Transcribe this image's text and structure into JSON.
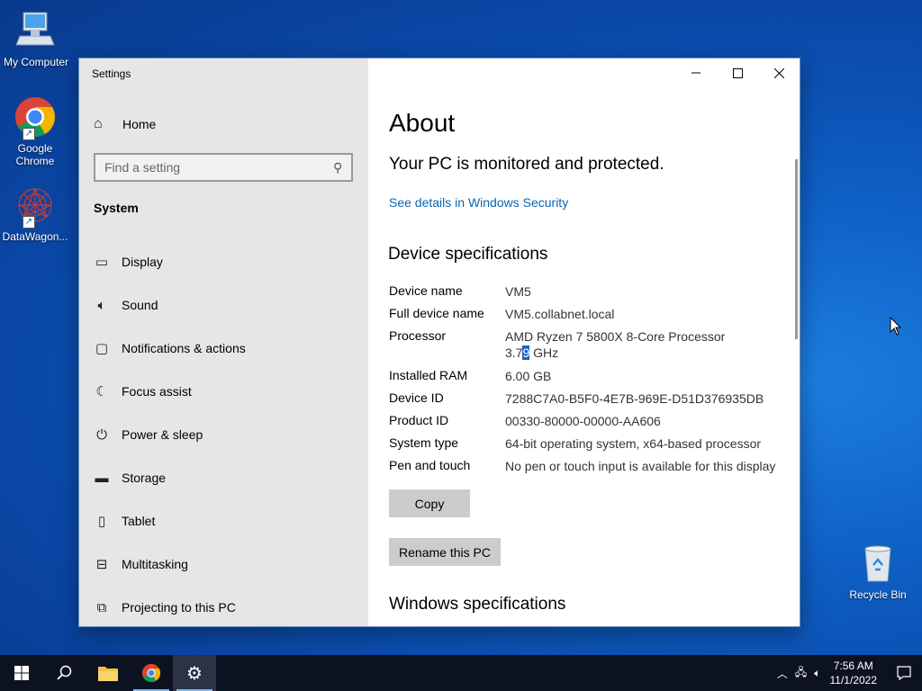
{
  "desktop": {
    "icons": [
      {
        "label": "My Computer"
      },
      {
        "label": "Google Chrome"
      },
      {
        "label": "DataWagon..."
      }
    ],
    "recycle_bin": "Recycle Bin"
  },
  "window": {
    "title": "Settings",
    "sidebar": {
      "home": "Home",
      "search_placeholder": "Find a setting",
      "section": "System",
      "items": [
        {
          "label": "Display",
          "icon": "display-icon"
        },
        {
          "label": "Sound",
          "icon": "sound-icon"
        },
        {
          "label": "Notifications & actions",
          "icon": "notifications-icon"
        },
        {
          "label": "Focus assist",
          "icon": "moon-icon"
        },
        {
          "label": "Power & sleep",
          "icon": "power-icon"
        },
        {
          "label": "Storage",
          "icon": "storage-icon"
        },
        {
          "label": "Tablet",
          "icon": "tablet-icon"
        },
        {
          "label": "Multitasking",
          "icon": "multitasking-icon"
        },
        {
          "label": "Projecting to this PC",
          "icon": "projecting-icon"
        }
      ]
    },
    "content": {
      "title": "About",
      "status": "Your PC is monitored and protected.",
      "security_link": "See details in Windows Security",
      "device_heading": "Device specifications",
      "specs": [
        {
          "key": "Device name",
          "value": "VM5"
        },
        {
          "key": "Full device name",
          "value": "VM5.collabnet.local"
        },
        {
          "key": "Processor",
          "value": "AMD Ryzen 7 5800X 8-Core Processor",
          "value2_pre": "3.7",
          "value2_sel": "9",
          "value2_post": " GHz"
        },
        {
          "key": "Installed RAM",
          "value": "6.00 GB"
        },
        {
          "key": "Device ID",
          "value": "7288C7A0-B5F0-4E7B-969E-D51D376935DB"
        },
        {
          "key": "Product ID",
          "value": "00330-80000-00000-AA606"
        },
        {
          "key": "System type",
          "value": "64-bit operating system, x64-based processor"
        },
        {
          "key": "Pen and touch",
          "value": "No pen or touch input is available for this display"
        }
      ],
      "copy_button": "Copy",
      "rename_button": "Rename this PC",
      "windows_heading": "Windows specifications"
    }
  },
  "taskbar": {
    "time": "7:56 AM",
    "date": "11/1/2022"
  }
}
